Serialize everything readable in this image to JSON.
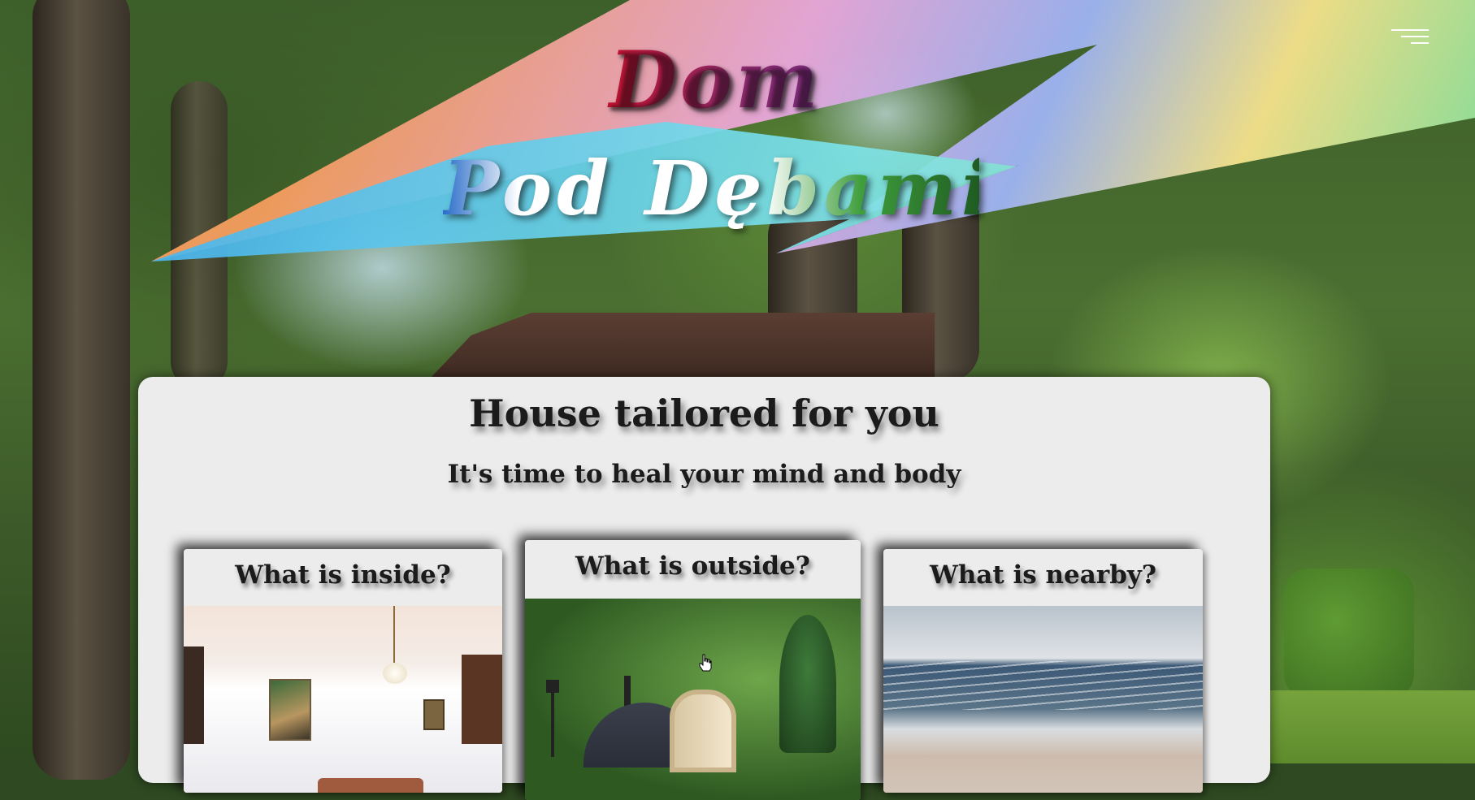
{
  "header": {
    "logo_line1": "Dom",
    "logo_line2": "Pod Dębami",
    "menu_icon": "hamburger-menu-icon"
  },
  "main": {
    "headline": "House tailored for you",
    "subline": "It's time to heal your mind and body",
    "cards": [
      {
        "title": "What is inside?",
        "image": "interior-photo"
      },
      {
        "title": "What is outside?",
        "image": "garden-sauna-photo"
      },
      {
        "title": "What is nearby?",
        "image": "beach-photo"
      }
    ]
  },
  "colors": {
    "panel_bg": "#ececec",
    "text": "#1b1b1b",
    "logo_dom": "#b3203a"
  }
}
